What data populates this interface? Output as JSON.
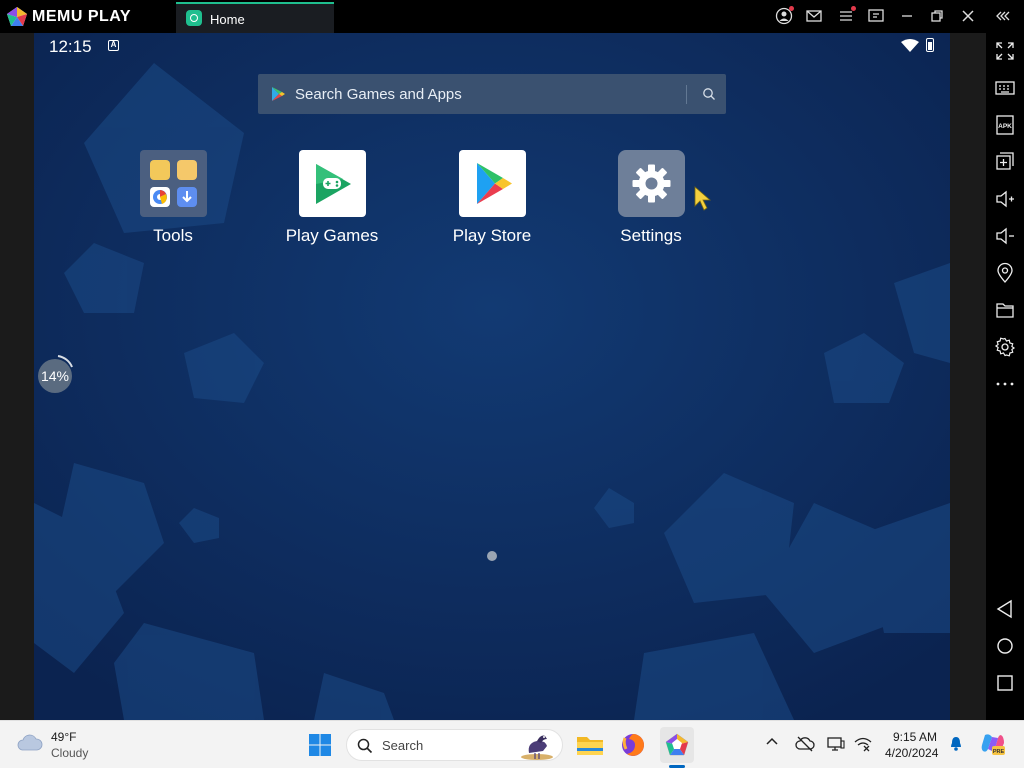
{
  "titlebar": {
    "brand": "MEMU PLAY",
    "tab_label": "Home",
    "icons": [
      "user-icon",
      "mail-icon",
      "menu-icon",
      "screen-share-icon",
      "minimize-icon",
      "restore-icon",
      "close-icon",
      "collapse-sidebar-icon"
    ]
  },
  "android": {
    "status_time": "12:15",
    "status_a": "A",
    "search_placeholder": "Search Games and Apps",
    "apps": [
      {
        "label": "Tools"
      },
      {
        "label": "Play Games"
      },
      {
        "label": "Play Store"
      },
      {
        "label": "Settings"
      }
    ],
    "progress_widget": "14%",
    "page_indicator_count": 1
  },
  "sidebar": {
    "icons": [
      "fullscreen-icon",
      "keyboard-icon",
      "apk-icon",
      "add-window-icon",
      "volume-up-icon",
      "volume-down-icon",
      "location-icon",
      "folder-icon",
      "settings-icon",
      "more-icon",
      "back-icon",
      "home-icon",
      "recents-icon"
    ],
    "apk_label": "APK"
  },
  "taskbar": {
    "weather_temp": "49°F",
    "weather_desc": "Cloudy",
    "search_label": "Search",
    "clock_time": "9:15 AM",
    "clock_date": "4/20/2024"
  },
  "colors": {
    "screen_bg": "#0f2d5c",
    "accent": "#1fbf8f"
  }
}
